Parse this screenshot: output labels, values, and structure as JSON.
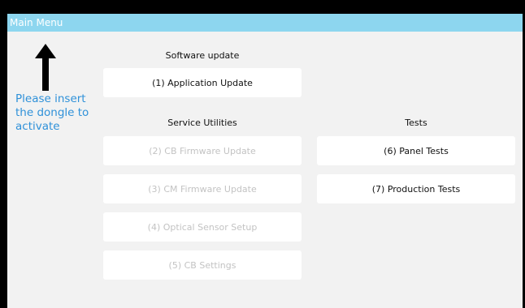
{
  "window": {
    "title": "Main Menu"
  },
  "hint": {
    "text": "Please insert the dongle to activate"
  },
  "software_update": {
    "heading": "Software update",
    "buttons": [
      {
        "label": "(1) Application Update",
        "enabled": true
      }
    ]
  },
  "service_utilities": {
    "heading": "Service Utilities",
    "buttons": [
      {
        "label": "(2) CB Firmware Update",
        "enabled": false
      },
      {
        "label": "(3) CM Firmware Update",
        "enabled": false
      },
      {
        "label": "(4) Optical Sensor Setup",
        "enabled": false
      },
      {
        "label": "(5) CB Settings",
        "enabled": false
      }
    ]
  },
  "tests": {
    "heading": "Tests",
    "buttons": [
      {
        "label": "(6) Panel Tests",
        "enabled": true
      },
      {
        "label": "(7) Production Tests",
        "enabled": true
      }
    ]
  },
  "colors": {
    "titlebar": "#8dd6ef",
    "hint_text": "#2f91d9",
    "disabled_text": "#c3c3c3"
  },
  "icons": {
    "hint_arrow": "arrow-up-icon"
  }
}
